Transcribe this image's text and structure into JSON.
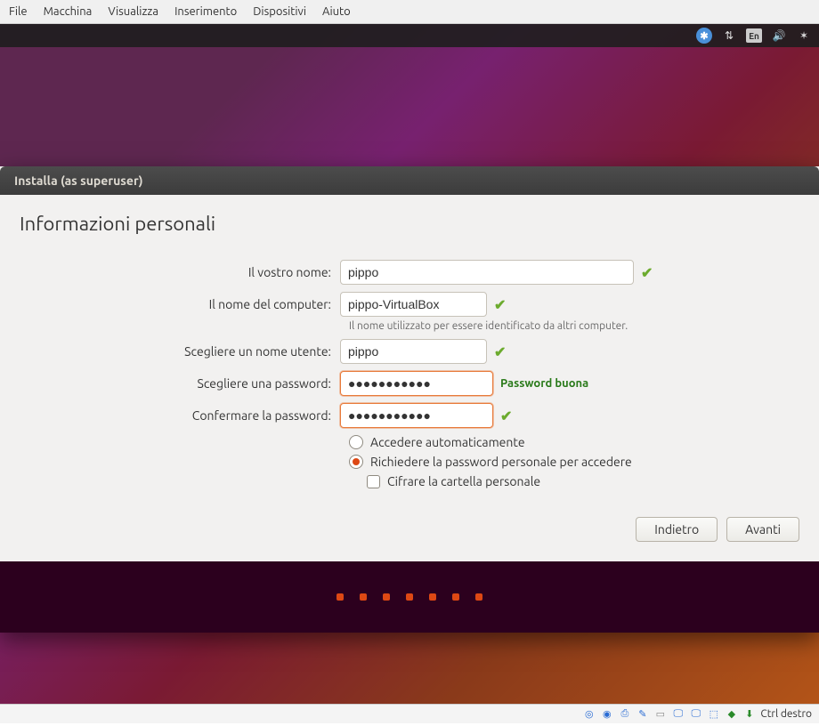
{
  "vm_menu": [
    "File",
    "Macchina",
    "Visualizza",
    "Inserimento",
    "Dispositivi",
    "Aiuto"
  ],
  "top_panel": {
    "lang": "En"
  },
  "installer": {
    "titlebar": "Installa (as superuser)",
    "heading": "Informazioni personali",
    "labels": {
      "name": "Il vostro nome:",
      "computer": "Il nome del computer:",
      "computer_hint": "Il nome utilizzato per essere identificato da altri computer.",
      "username": "Scegliere un nome utente:",
      "password": "Scegliere una password:",
      "confirm": "Confermare la password:"
    },
    "values": {
      "name": "pippo",
      "computer": "pippo-VirtualBox",
      "username": "pippo",
      "password": "●●●●●●●●●●●",
      "confirm": "●●●●●●●●●●●"
    },
    "password_strength": "Password buona",
    "options": {
      "auto_login": "Accedere automaticamente",
      "require_pw": "Richiedere la password personale per accedere",
      "encrypt": "Cifrare la cartella personale"
    },
    "buttons": {
      "back": "Indietro",
      "next": "Avanti"
    }
  },
  "statusbar": {
    "host_key": "Ctrl destro"
  }
}
